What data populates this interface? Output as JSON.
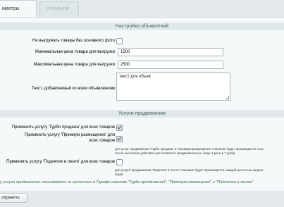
{
  "tabs": [
    {
      "label": "иметры"
    },
    {
      "label": "Результат"
    }
  ],
  "section_ads": {
    "title": "Настройка объявлений",
    "no_photo_label": "Не выгружать товары без основного фото",
    "no_photo_checked": false,
    "min_price_label": "Минимальная цена товара для выгрузки",
    "min_price_value": "1500",
    "max_price_label": "Максимальная цена товара для выгрузки",
    "max_price_value": "2500",
    "text_label": "Текст, добавляемый ко всем объявлениям",
    "text_value": "текст для объяв"
  },
  "section_services": {
    "title": "Услуги продвижения",
    "turbo_label": "Применить услугу 'Турбо продажа' для всех товаров",
    "turbo_checked": true,
    "premium_label": "Применить услугу 'Премиум размещение' для всех товаров",
    "premium_checked": true,
    "premium_note_1": "для услуг продвижения 'Турбо продажа' и 'Премиум размещение' списание будут производится толь",
    "premium_note_2": "после окончания действия уже активного продвижения (не чаще 1 раза в 7 дней)",
    "raise_label": "Применить услугу 'Поднятие в ленте' для всех товаров",
    "raise_checked": false,
    "raise_note_1": "для услуги продвижения 'Поднятие в ленте' списание будет производится каждый раз после загрузк",
    "raise_note_2": "фида"
  },
  "footer": {
    "note": "у услуги продвижения списываются из купленных в Тарифе пакетов \"Турбо продвижений\", \"Премиум размещений\" и \"Поднятия в ленте\"",
    "save_label": "охранить"
  }
}
